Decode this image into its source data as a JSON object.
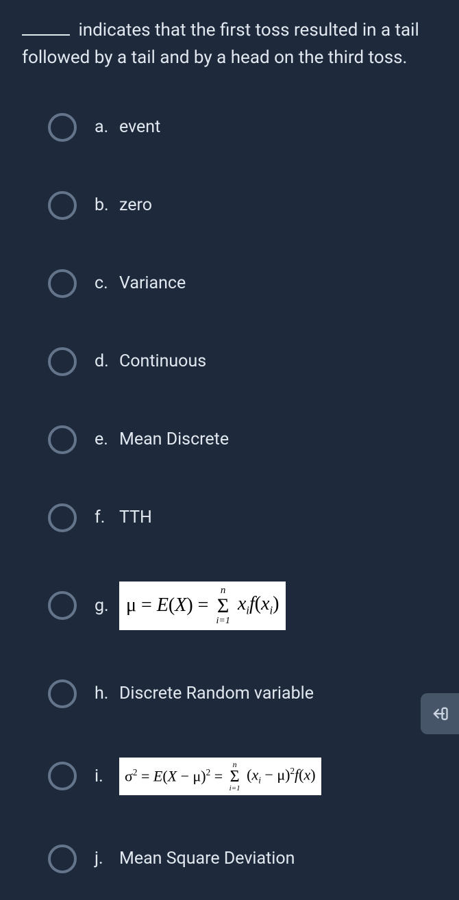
{
  "question": {
    "stem": "indicates that the first toss resulted in a tail followed by a tail and by a head on the third toss."
  },
  "options": [
    {
      "letter": "a.",
      "text": "event",
      "type": "text"
    },
    {
      "letter": "b.",
      "text": "zero",
      "type": "text"
    },
    {
      "letter": "c.",
      "text": "Variance",
      "type": "text"
    },
    {
      "letter": "d.",
      "text": "Continuous",
      "type": "text"
    },
    {
      "letter": "e.",
      "text": "Mean Discrete",
      "type": "text"
    },
    {
      "letter": "f.",
      "text": "TTH",
      "type": "text"
    },
    {
      "letter": "g.",
      "text": "μ = E(X) = Σ_{i=1}^{n} x_i f(x_i)",
      "type": "formula_mean"
    },
    {
      "letter": "h.",
      "text": "Discrete Random variable",
      "type": "text"
    },
    {
      "letter": "i.",
      "text": "σ² = E(X − μ)² = Σ_{i=1}^{n} (x_i − μ)² f(x)",
      "type": "formula_variance"
    },
    {
      "letter": "j.",
      "text": "Mean Square Deviation",
      "type": "text"
    }
  ],
  "side_tab": {
    "icon": "logout-icon"
  }
}
